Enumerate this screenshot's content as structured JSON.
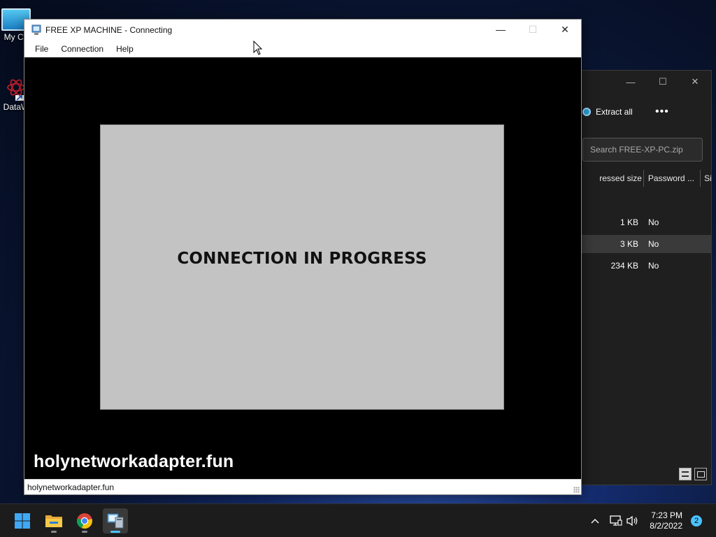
{
  "desktop": {
    "icons": [
      {
        "label": "My Co",
        "icon": "computer-icon"
      },
      {
        "label": "DataW",
        "icon": "datawrapper-icon"
      }
    ]
  },
  "background_window": {
    "caption_buttons": {
      "minimize": "—",
      "maximize": "☐",
      "close": "✕"
    },
    "extract_all_label": "Extract all",
    "more_label": "•••",
    "search_placeholder": "Search FREE-XP-PC.zip",
    "columns": [
      "ressed size",
      "Password ...",
      "Si"
    ],
    "rows": [
      {
        "size": "1 KB",
        "password": "No",
        "selected": false
      },
      {
        "size": "3 KB",
        "password": "No",
        "selected": true
      },
      {
        "size": "234 KB",
        "password": "No",
        "selected": false
      }
    ]
  },
  "main_window": {
    "title": "FREE XP MACHINE - Connecting",
    "caption_buttons": {
      "minimize": "—",
      "maximize": "☐",
      "close": "✕"
    },
    "menu": [
      "File",
      "Connection",
      "Help"
    ],
    "connection_message": "CONNECTION IN PROGRESS",
    "watermark": "holynetworkadapter.fun",
    "status_text": "holynetworkadapter.fun"
  },
  "taskbar": {
    "apps": [
      {
        "name": "start",
        "icon": "windows-start-icon"
      },
      {
        "name": "file-explorer",
        "icon": "folder-icon"
      },
      {
        "name": "chrome",
        "icon": "chrome-icon"
      },
      {
        "name": "remote-desktop",
        "icon": "remote-desktop-icon",
        "active": true
      }
    ],
    "tray_icons": [
      "chevron-up-icon",
      "network-icon",
      "volume-icon"
    ],
    "time": "7:23 PM",
    "date": "8/2/2022",
    "notification_count": "2"
  },
  "colors": {
    "accent": "#4cc2ff",
    "connection_panel": "#c3c3c3",
    "dark_window": "#1f1f1f"
  }
}
